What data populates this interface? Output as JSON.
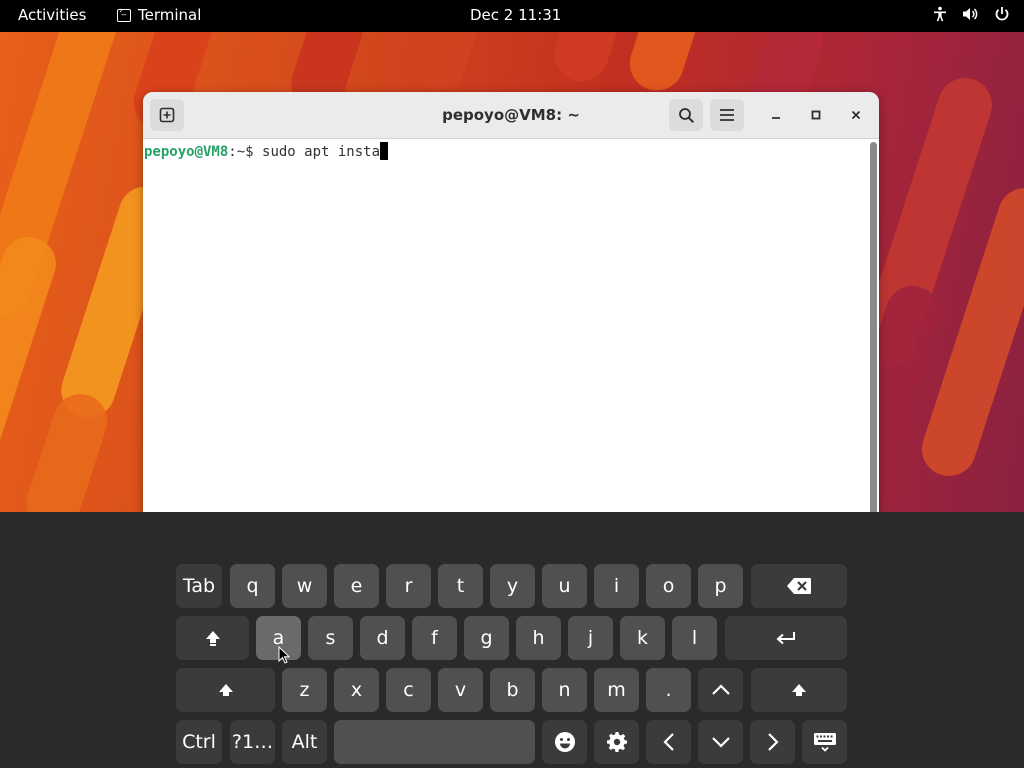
{
  "topbar": {
    "activities": "Activities",
    "app_name": "Terminal",
    "clock": "Dec 2  11:31"
  },
  "terminal": {
    "title": "pepoyo@VM8: ~",
    "prompt_user": "pepoyo@VM8",
    "prompt_path": ":~$",
    "command": " sudo apt insta"
  },
  "keyboard": {
    "row1": [
      "Tab",
      "q",
      "w",
      "e",
      "r",
      "t",
      "y",
      "u",
      "i",
      "o",
      "p"
    ],
    "row2": [
      "a",
      "s",
      "d",
      "f",
      "g",
      "h",
      "j",
      "k",
      "l"
    ],
    "row3": [
      "z",
      "x",
      "c",
      "v",
      "b",
      "n",
      "m",
      "."
    ],
    "row4": [
      "Ctrl",
      "?1…",
      "Alt"
    ],
    "icons": {
      "backspace": "backspace-icon",
      "enter": "enter-icon",
      "shift": "shift-icon",
      "up": "chevron-up-icon",
      "down": "chevron-down-icon",
      "left": "chevron-left-icon",
      "right": "chevron-right-icon",
      "emoji": "emoji-icon",
      "settings": "gear-icon",
      "hide": "keyboard-hide-icon"
    }
  },
  "colors": {
    "prompt_user": "#26a269",
    "topbar": "#000000",
    "keyboard_bg": "#2a2a2a"
  }
}
